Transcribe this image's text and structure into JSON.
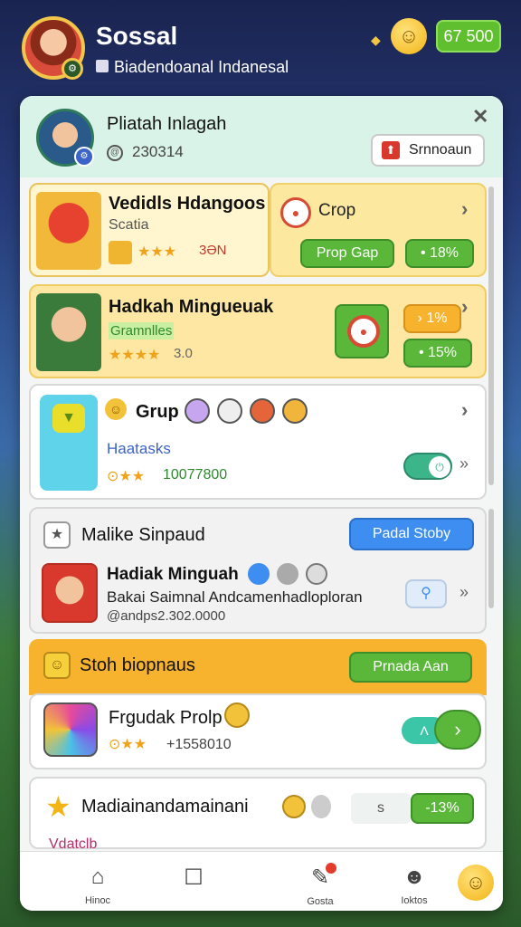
{
  "header": {
    "title": "Sossal",
    "subtitle": "Biadendoanal Indanesal",
    "coins": "67 500",
    "avatar_badge": "⚙"
  },
  "profile": {
    "name": "Pliatah Inlagah",
    "id": "230314",
    "button_label": "Srnnoaun",
    "close_label": "✕"
  },
  "cards": {
    "c1": {
      "title": "Vedidls Hdangoos",
      "subtitle": "Scatia",
      "value": "3ƏN",
      "stars": "★★★"
    },
    "c2": {
      "title": "Crop",
      "button1": "Prop Gap",
      "button2": "• 18%"
    },
    "c3": {
      "title": "Hadkah Minguеuak",
      "subtitle": "Gramnlles",
      "value": "3.0",
      "stars": "★★★★",
      "badge1": "› 1%",
      "badge2": "• 15%"
    },
    "c4": {
      "title": "Grup",
      "subtitle": "Haatasks",
      "value": "10077800",
      "stars": "⊙★★"
    },
    "c5": {
      "header": "Malike Sinpaud",
      "button": "Padal Stoby",
      "name": "Hadiak Minguah",
      "description": "Bakai Saimnal Andcamenhadloploran",
      "id": "@andps2.302.0000"
    },
    "section": {
      "title": "Stoh biopnaus",
      "button": "Prnada Aan"
    },
    "c6": {
      "title": "Frgudak Prolp",
      "value": "+1558010",
      "stars": "⊙★★"
    },
    "c7": {
      "title": "Madiainandamainani",
      "pill": "s",
      "button": "-13%",
      "peek": "Vdatclb"
    }
  },
  "nav": {
    "items": [
      {
        "label": "Hinoc",
        "icon": "home-icon"
      },
      {
        "label": "",
        "icon": "chart-icon"
      },
      {
        "label": "Gosta",
        "icon": "edit-icon"
      },
      {
        "label": "Ioktos",
        "icon": "profile-icon"
      }
    ]
  },
  "colors": {
    "accent": "#5ab73a",
    "panel": "#f3f6f4",
    "gold": "#f7b22e"
  }
}
